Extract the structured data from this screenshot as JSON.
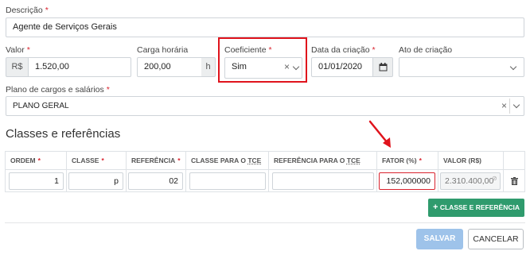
{
  "form": {
    "descricao": {
      "label": "Descrição",
      "value": "Agente de Serviços Gerais"
    },
    "valor": {
      "label": "Valor",
      "prefix": "R$",
      "value": "1.520,00"
    },
    "carga_horaria": {
      "label": "Carga horária",
      "value": "200,00",
      "suffix": "h"
    },
    "coeficiente": {
      "label": "Coeficiente",
      "value": "Sim"
    },
    "data_criacao": {
      "label": "Data da criação",
      "value": "01/01/2020"
    },
    "ato_criacao": {
      "label": "Ato de criação",
      "value": ""
    },
    "plano": {
      "label": "Plano de cargos e salários",
      "value": "PLANO GERAL"
    },
    "required_mark": "*"
  },
  "section": {
    "title": "Classes e referências"
  },
  "table": {
    "headers": {
      "ordem": "ORDEM",
      "classe": "CLASSE",
      "referencia": "REFERÊNCIA",
      "classe_tce_prefix": "CLASSE PARA O ",
      "referencia_tce_prefix": "REFERÊNCIA PARA O ",
      "tce": "TCE",
      "fator": "FATOR (%)",
      "valor": "VALOR (R$)"
    },
    "rows": [
      {
        "ordem": "1",
        "classe": "p",
        "referencia": "02",
        "classe_tce": "",
        "referencia_tce": "",
        "fator": "152,000000",
        "valor": "2.310.400,00"
      }
    ]
  },
  "buttons": {
    "add_classe": "CLASSE E REFERÊNCIA",
    "save": "SALVAR",
    "cancel": "CANCELAR"
  },
  "colors": {
    "required": "#d9232e",
    "annotation": "#e0131c",
    "primary_green": "#2f9b6d",
    "save_disabled": "#9ec3ea"
  }
}
